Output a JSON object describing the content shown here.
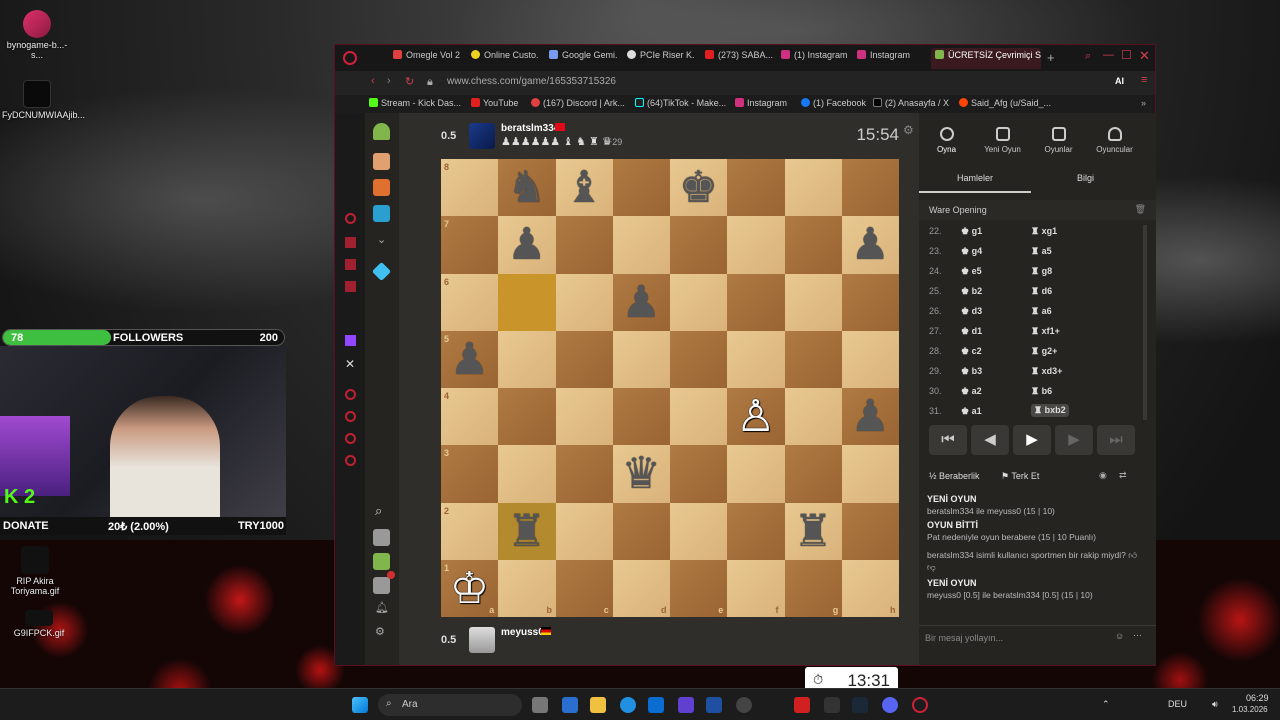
{
  "desktop": {
    "icons": [
      {
        "label": "bynogame-b...-s..."
      },
      {
        "label": "FyDCNUMWIAAjib..."
      },
      {
        "label": "RIP Akira Toriyama.gif"
      },
      {
        "label": "G9IFPCK.gif"
      }
    ],
    "followers": {
      "current": "78",
      "label": "FOLLOWERS",
      "goal": "200",
      "progress": 0.39
    },
    "donate": {
      "label": "DONATE",
      "amount": "20₺ (2.00%)",
      "goal": "TRY1000"
    },
    "kick_count": "2"
  },
  "browser": {
    "tabs": [
      "Omegle Vol 2",
      "Online Custo...",
      "Google Gemi...",
      "PCIe Riser K...",
      "(273) SABA...",
      "(1) Instagram",
      "Instagram",
      "ÜCRETSİZ Çevrimiçi S..."
    ],
    "url": "www.chess.com/game/165353715326",
    "bookmarks": [
      "Stream - Kick Das...",
      "YouTube",
      "(167) Discord | Ark...",
      "(64)TikTok - Make...",
      "Instagram",
      "(1) Facebook",
      "(2) Anasayfa / X",
      "Said_Afg (u/Said_..."
    ],
    "ai_label": "AI"
  },
  "game": {
    "top_player": {
      "score": "0.5",
      "name": "beratslm334",
      "material_diff": "+29",
      "clock": "15:54"
    },
    "bottom_player": {
      "score": "0.5",
      "name": "meyuss0",
      "clock": "13:31"
    },
    "files": [
      "a",
      "b",
      "c",
      "d",
      "e",
      "f",
      "g",
      "h"
    ],
    "ranks": [
      "8",
      "7",
      "6",
      "5",
      "4",
      "3",
      "2",
      "1"
    ],
    "pieces": [
      {
        "sq": "b8",
        "glyph": "♞",
        "color": "black"
      },
      {
        "sq": "c8",
        "glyph": "♝",
        "color": "black"
      },
      {
        "sq": "e8",
        "glyph": "♚",
        "color": "black"
      },
      {
        "sq": "b7",
        "glyph": "♟",
        "color": "black"
      },
      {
        "sq": "h7",
        "glyph": "♟",
        "color": "black"
      },
      {
        "sq": "d6",
        "glyph": "♟",
        "color": "black"
      },
      {
        "sq": "a5",
        "glyph": "♟",
        "color": "black"
      },
      {
        "sq": "f4",
        "glyph": "♙",
        "color": "white"
      },
      {
        "sq": "h4",
        "glyph": "♟",
        "color": "black"
      },
      {
        "sq": "d3",
        "glyph": "♛",
        "color": "black"
      },
      {
        "sq": "b2",
        "glyph": "♜",
        "color": "black"
      },
      {
        "sq": "g2",
        "glyph": "♜",
        "color": "black"
      },
      {
        "sq": "a1",
        "glyph": "♔",
        "color": "white"
      }
    ],
    "highlight": [
      "b6",
      "b2"
    ]
  },
  "panel": {
    "tabs": [
      "Oyna",
      "Yeni Oyun",
      "Oyunlar",
      "Oyuncular"
    ],
    "subtabs": [
      "Hamleler",
      "Bilgi"
    ],
    "opening": "Ware Opening",
    "moves": [
      {
        "n": "22.",
        "w": "g1",
        "b": "xg1"
      },
      {
        "n": "23.",
        "w": "g4",
        "b": "a5"
      },
      {
        "n": "24.",
        "w": "e5",
        "b": "g8"
      },
      {
        "n": "25.",
        "w": "b2",
        "b": "d6"
      },
      {
        "n": "26.",
        "w": "d3",
        "b": "a6"
      },
      {
        "n": "27.",
        "w": "d1",
        "b": "xf1+"
      },
      {
        "n": "28.",
        "w": "c2",
        "b": "g2+"
      },
      {
        "n": "29.",
        "w": "b3",
        "b": "xd3+"
      },
      {
        "n": "30.",
        "w": "a2",
        "b": "b6"
      },
      {
        "n": "31.",
        "w": "a1",
        "b": "bxb2"
      }
    ],
    "actions": {
      "draw": "Beraberlik",
      "resign": "Terk Et"
    },
    "chat": [
      {
        "title": "YENİ OYUN",
        "text": "beratslm334 ile meyuss0 (15 | 10)"
      },
      {
        "title": "OYUN BİTTİ",
        "text": "Pat nedeniyle oyun berabere (15 | 10 Puanlı)"
      },
      {
        "title": "",
        "text": "beratslm334 isimli kullanıcı sportmen bir rakip miydi?"
      },
      {
        "title": "YENİ OYUN",
        "text": "meyuss0 [0.5] ile beratslm334 [0.5] (15 | 10)"
      }
    ],
    "chat_placeholder": "Bir mesaj yollayın..."
  },
  "taskbar": {
    "search": "Ara",
    "lang": "DEU",
    "time": "06:29",
    "date": "1.03.2026"
  }
}
